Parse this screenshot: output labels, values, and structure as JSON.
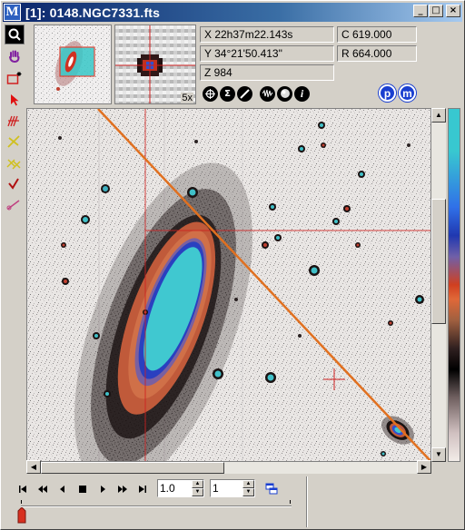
{
  "window": {
    "title": "[1]: 0148.NGC7331.fts",
    "buttons": {
      "minimize": "_",
      "maximize": "□",
      "close": "×"
    }
  },
  "info": {
    "ra": "X 22h37m22.143s",
    "dec": "Y 34°21'50.413\"",
    "z": "Z 984",
    "col": "C 619.000",
    "row": "R 664.000",
    "zoom": "5x"
  },
  "actions": [
    "crosshair-icon",
    "sigma-icon",
    "measure-icon",
    "waveform-icon",
    "sphere-icon",
    "info-icon"
  ],
  "pm_buttons": {
    "p": "p",
    "m": "m"
  },
  "playback": {
    "speed": "1.0",
    "frame": "1",
    "buttons": [
      "first",
      "rewind",
      "back",
      "stop",
      "play",
      "fast-forward",
      "last"
    ]
  },
  "colors": {
    "title_start": "#0a246a",
    "title_end": "#a6caf0",
    "overlay_line": "#e07020",
    "crosshair": "#d02020",
    "accent_blue": "#1a3fd0"
  }
}
